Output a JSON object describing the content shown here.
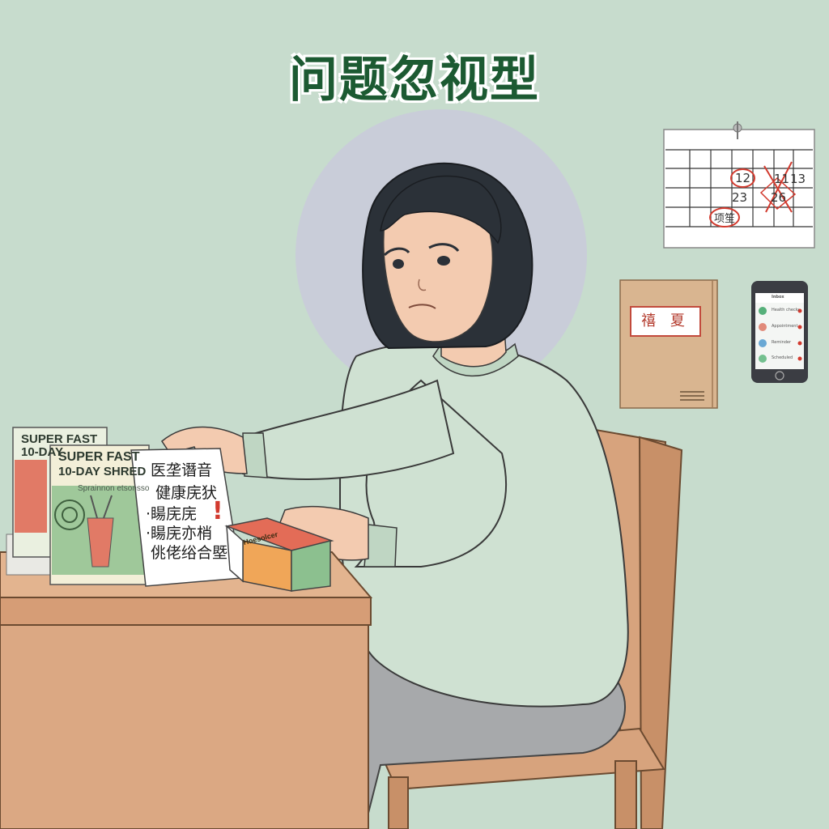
{
  "title": "问题忽视型",
  "calendar": {
    "numbers": [
      "12",
      "11",
      "13",
      "23",
      "26",
      "项笙"
    ]
  },
  "folder": {
    "label": "禧 夏"
  },
  "phone": {
    "header": "Inbox",
    "rows": [
      "Health checkup",
      "Appointment",
      "Reminder",
      "Scheduled"
    ]
  },
  "magazines": {
    "back_title_line1": "SUPER FAST",
    "back_title_line2": "10-DAY",
    "front_title_line1": "SUPER FAST",
    "front_title_line2": "10-DAY SHRED",
    "front_subtitle": "Sprainnon etsonsso"
  },
  "paper": {
    "lines": [
      "医垄谮音",
      "健康庑犾",
      "·䁑庑庑",
      "·䁑庑亦梢",
      "佻佬绤合塈"
    ],
    "exclaim": "!"
  },
  "box": {
    "label": "Hoesolcer"
  },
  "colors": {
    "background": "#c7dccd",
    "title": "#1c5a32",
    "sweater": "#cfe1d2",
    "desk": "#dba883",
    "alert_red": "#d23a2e"
  }
}
